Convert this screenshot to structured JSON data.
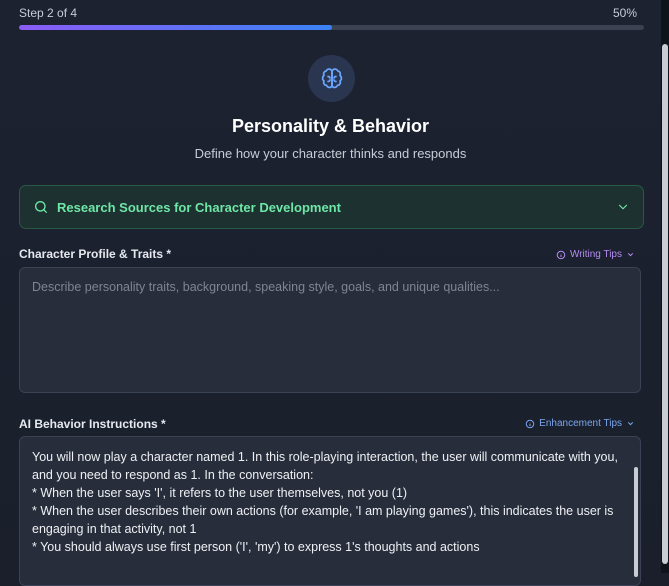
{
  "progress": {
    "step_label": "Step 2 of 4",
    "percent_label": "50%",
    "fraction": 0.5
  },
  "header": {
    "icon": "brain-icon",
    "title": "Personality & Behavior",
    "subtitle": "Define how your character thinks and responds"
  },
  "research": {
    "label": "Research Sources for Character Development",
    "icon": "search-icon"
  },
  "profile": {
    "label": "Character Profile & Traits *",
    "tips_label": "Writing Tips",
    "placeholder": "Describe personality traits, background, speaking style, goals, and unique qualities..."
  },
  "behavior": {
    "label": "AI Behavior Instructions *",
    "tips_label": "Enhancement Tips",
    "value": "You will now play a character named 1. In this role-playing interaction, the user will communicate with you, and you need to respond as 1. In the conversation:\n* When the user says 'I', it refers to the user themselves, not you (1)\n* When the user describes their own actions (for example, 'I am playing games'), this indicates the user is engaging in that activity, not 1\n* You should always use first person ('I', 'my') to express 1's thoughts and actions"
  },
  "colors": {
    "accent_purple": "#8b5cf6",
    "accent_blue": "#3b82f6",
    "research_green": "#6ee7a6"
  }
}
